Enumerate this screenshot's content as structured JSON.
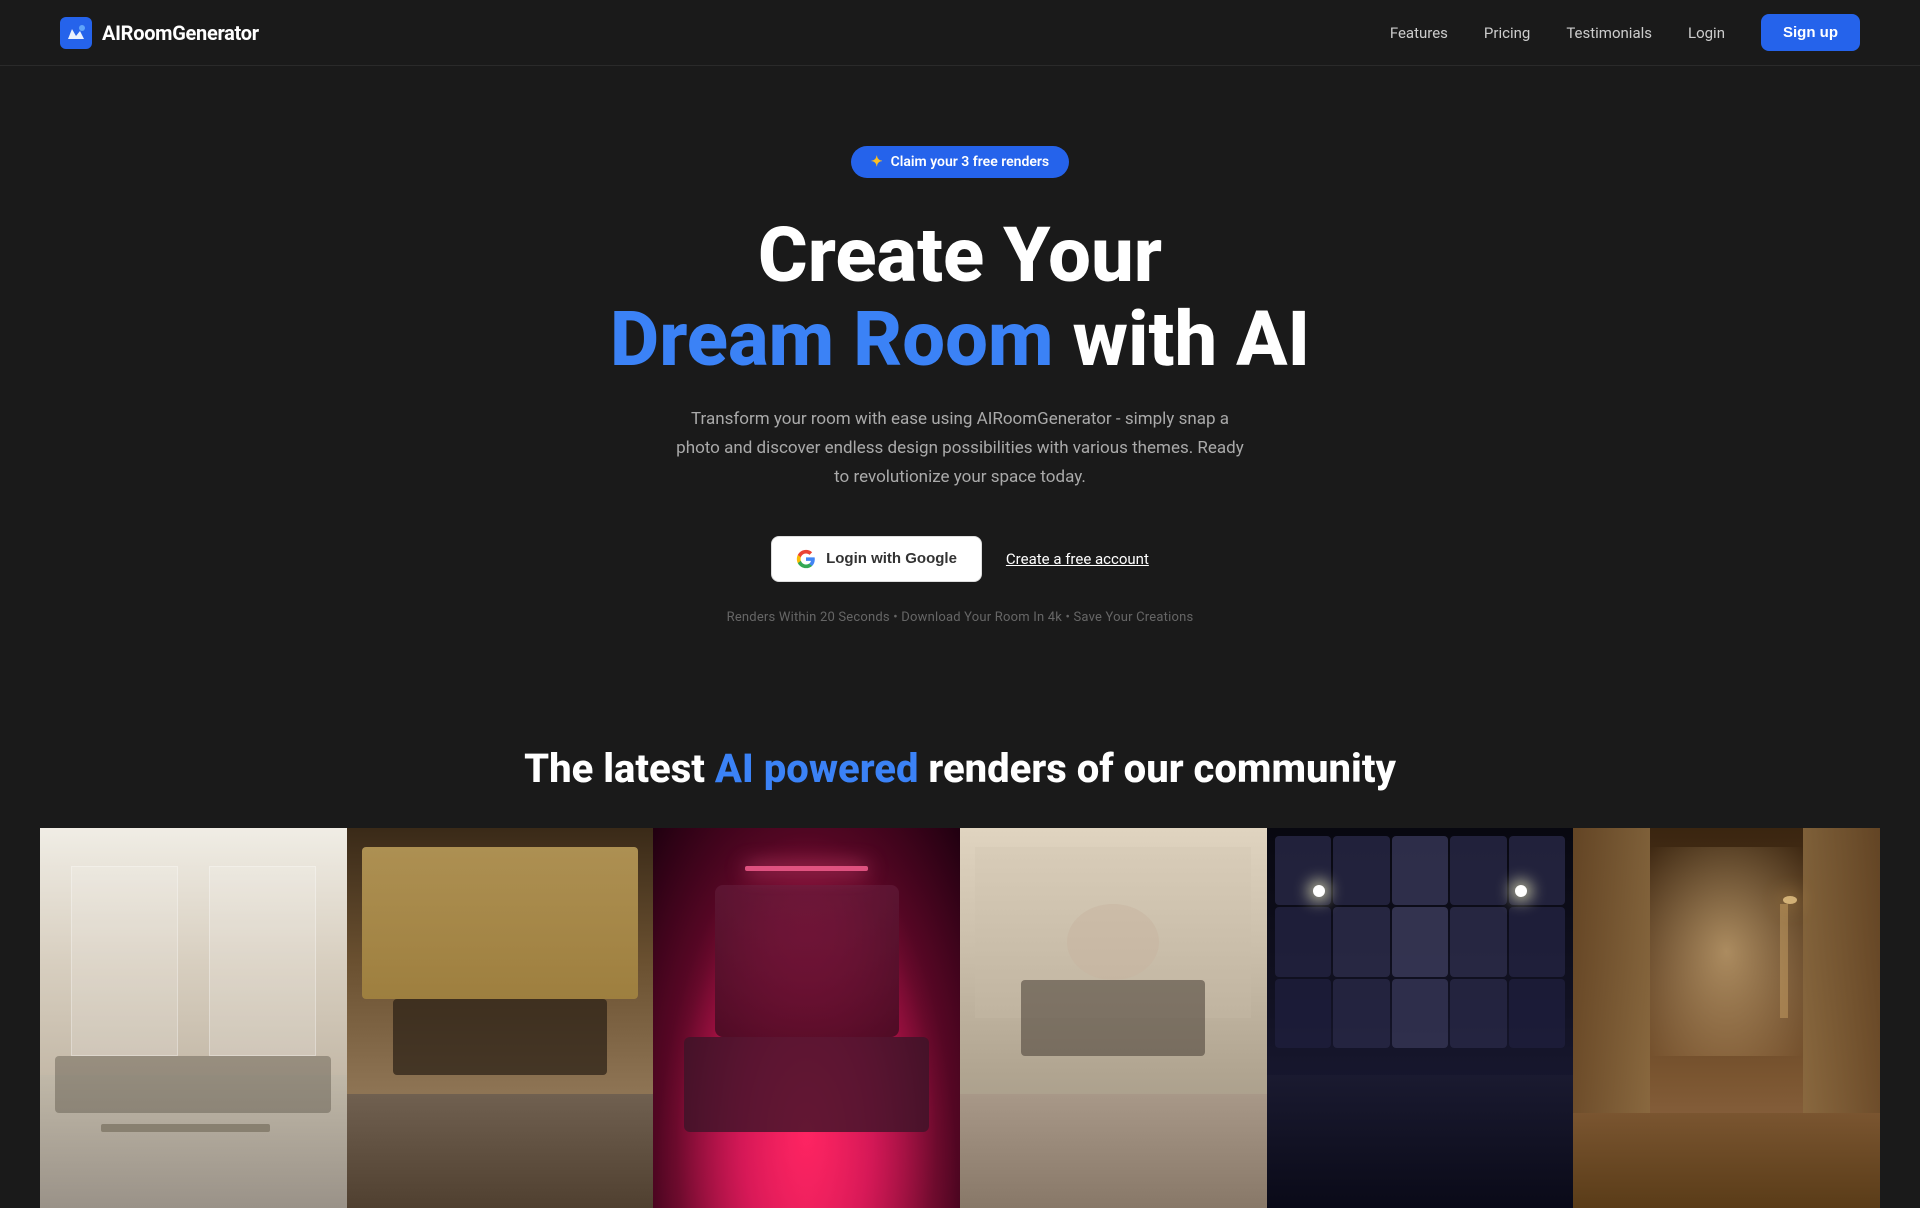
{
  "header": {
    "logo_text": "AIRoomGenerator",
    "nav": {
      "features_label": "Features",
      "pricing_label": "Pricing",
      "testimonials_label": "Testimonials",
      "login_label": "Login",
      "signup_label": "Sign up"
    }
  },
  "hero": {
    "claim_badge": "Claim your 3 free renders",
    "title_line1": "Create Your",
    "title_blue": "Dream Room",
    "title_line2": "with AI",
    "description": "Transform your room with ease using AIRoomGenerator - simply snap a photo and discover endless design possibilities with various themes. Ready to revolutionize your space today.",
    "google_button_label": "Login with Google",
    "free_account_label": "Create a free account",
    "features_text": "Renders Within 20 Seconds • Download Your Room In 4k • Save Your Creations"
  },
  "community": {
    "title_before": "The latest ",
    "title_blue": "AI powered",
    "title_after": " renders of our community"
  },
  "gallery": {
    "images": [
      {
        "alt": "Modern light living room render"
      },
      {
        "alt": "Warm bedroom with wood tones render"
      },
      {
        "alt": "Pink neon bedroom render"
      },
      {
        "alt": "Classic bedroom render"
      },
      {
        "alt": "Dark tufted bedroom render"
      },
      {
        "alt": "Warm curtained bedroom render"
      }
    ]
  },
  "colors": {
    "accent_blue": "#3b82f6",
    "cta_blue": "#2563eb"
  }
}
